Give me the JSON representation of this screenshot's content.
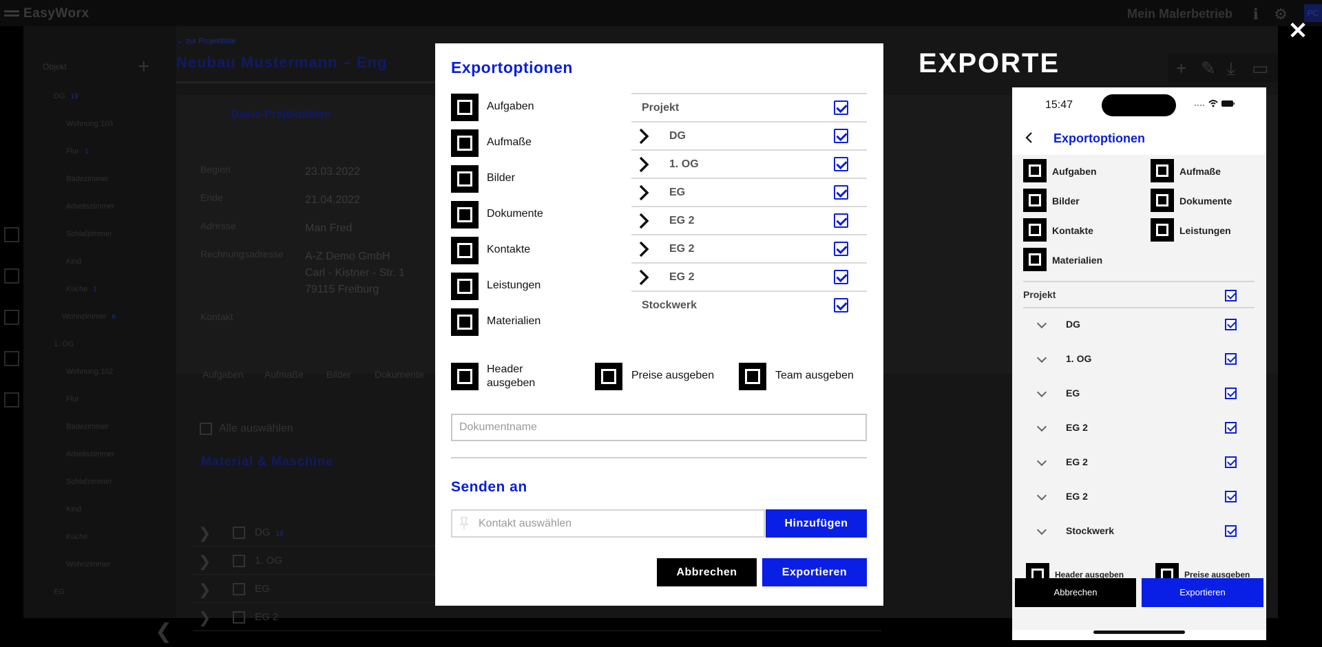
{
  "app": {
    "brand": "EasyWorx",
    "tenant": "Mein Malerbetrieb",
    "user_initials": "PC"
  },
  "sidebar": {
    "header": "Objekt",
    "items": [
      {
        "label": "DG",
        "badge": "19"
      },
      {
        "label": "Wohnung 103"
      },
      {
        "label": "Flur",
        "badge": "1"
      },
      {
        "label": "Badezimmer"
      },
      {
        "label": "Arbeitszimmer"
      },
      {
        "label": "Schlafzimmer"
      },
      {
        "label": "Kind"
      },
      {
        "label": "Küche",
        "badge": "1"
      },
      {
        "label": "Wohnzimmer",
        "badge": "6"
      },
      {
        "label": "1. OG"
      },
      {
        "label": "Wohnung 102"
      },
      {
        "label": "Flur"
      },
      {
        "label": "Badezimmer"
      },
      {
        "label": "Arbeitszimmer"
      },
      {
        "label": "Schlafzimmer"
      },
      {
        "label": "Kind"
      },
      {
        "label": "Küche"
      },
      {
        "label": "Wohnzimmer"
      },
      {
        "label": "EG"
      }
    ]
  },
  "project": {
    "breadcrumb": "zur Projektliste",
    "title": "Neubau Mustermann – Eng",
    "base_section": "Basis-Projektdaten",
    "fields": {
      "begin_label": "Beginn",
      "begin_value": "23.03.2022",
      "end_label": "Ende",
      "end_value": "21.04.2022",
      "address_label": "Adresse",
      "address_value": "Man Fred",
      "billing_label": "Rechnungsadresse",
      "billing_line1": "A-Z Demo GmbH",
      "billing_line2": "Carl - Kistner - Str. 1",
      "billing_line3": "79115 Freiburg",
      "contact_label": "Kontakt"
    },
    "tabs": [
      "Aufgaben",
      "Aufmaße",
      "Bilder",
      "Dokumente"
    ],
    "select_all": "Alle auswählen",
    "material_section": "Material & Maschine",
    "tree": [
      {
        "label": "DG",
        "badge": "19"
      },
      {
        "label": "1. OG"
      },
      {
        "label": "EG"
      },
      {
        "label": "EG 2"
      },
      {
        "label": "EG 2"
      }
    ]
  },
  "modal": {
    "title": "Exportoptionen",
    "options": [
      "Aufgaben",
      "Aufmaße",
      "Bilder",
      "Dokumente",
      "Kontakte",
      "Leistungen",
      "Materialien"
    ],
    "tree_header": "Projekt",
    "tree": [
      "DG",
      "1. OG",
      "EG",
      "EG 2",
      "EG 2",
      "EG 2"
    ],
    "tree_footer": "Stockwerk",
    "extra_header_line1": "Header",
    "extra_header_line2": "ausgeben",
    "extra_prices": "Preise ausgeben",
    "extra_team": "Team ausgeben",
    "docname_placeholder": "Dokumentname",
    "send_title": "Senden an",
    "contact_placeholder": "Kontakt auswählen",
    "add_button": "Hinzufügen",
    "cancel_button": "Abbrechen",
    "export_button": "Exportieren"
  },
  "exporte": {
    "title": "EXPORTE",
    "close_icon": "close-icon"
  },
  "phone": {
    "time": "15:47",
    "title": "Exportoptionen",
    "options": [
      "Aufgaben",
      "Aufmaße",
      "Bilder",
      "Dokumente",
      "Kontakte",
      "Leistungen",
      "Materialien"
    ],
    "tree_header": "Projekt",
    "tree": [
      "DG",
      "1. OG",
      "EG",
      "EG 2",
      "EG 2",
      "EG 2",
      "Stockwerk"
    ],
    "extra_header": "Header ausgeben",
    "extra_prices": "Preise ausgeben",
    "cancel_button": "Abbrechen",
    "export_button": "Exportieren"
  },
  "colors": {
    "accent": "#0a1fe6",
    "black": "#000000",
    "overlay": "#000000"
  }
}
